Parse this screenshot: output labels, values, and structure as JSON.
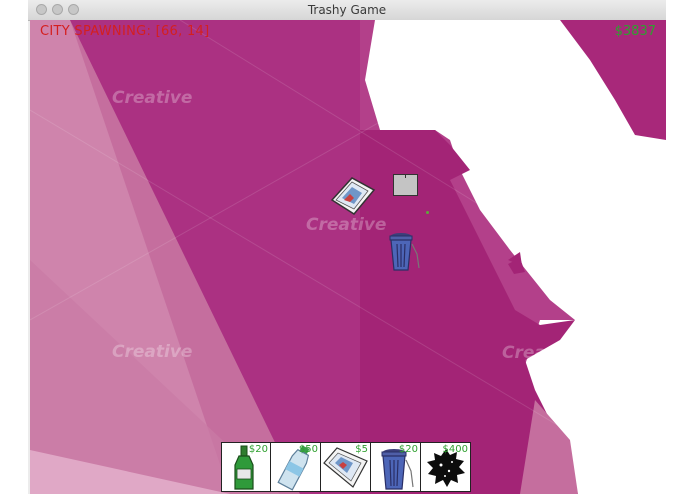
{
  "window": {
    "title": "Trashy Game"
  },
  "hud": {
    "spawn_label": "CITY SPAWNING: [66, 14]",
    "money": "$3837",
    "spawn_color": "#d41f1f",
    "money_color": "#2fa02f"
  },
  "watermarks": [
    "Creative",
    "Creative",
    "Creative",
    "Creative",
    "Creative"
  ],
  "world_sprites": [
    {
      "name": "newspaper-icon"
    },
    {
      "name": "trash-bin-icon"
    },
    {
      "name": "placement-cursor"
    }
  ],
  "shop": {
    "items": [
      {
        "name": "bottle",
        "price": "$20",
        "icon": "glass-bottle-icon"
      },
      {
        "name": "plastic-bottle",
        "price": "$50",
        "icon": "plastic-bottle-icon"
      },
      {
        "name": "newspaper",
        "price": "$5",
        "icon": "newspaper-icon"
      },
      {
        "name": "trash-bin",
        "price": "$20",
        "icon": "trash-bin-icon"
      },
      {
        "name": "black-hole",
        "price": "$400",
        "icon": "black-hole-icon"
      }
    ]
  },
  "colors": {
    "magenta_dark": "#a8287a",
    "magenta": "#b3408a",
    "magenta_light": "#c9739f",
    "pink_light": "#d99ab8"
  }
}
